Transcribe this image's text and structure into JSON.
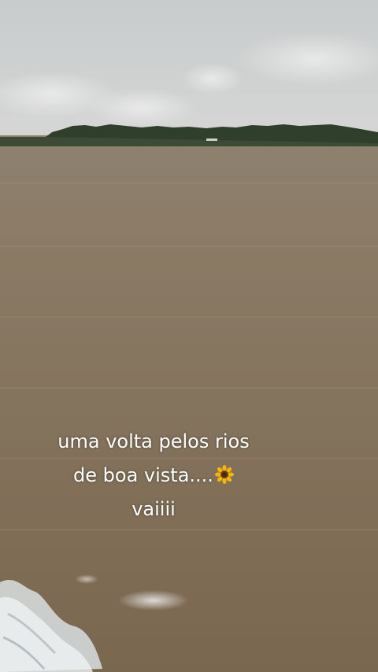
{
  "caption": {
    "line1": "uma volta pelos rios",
    "line2": "de boa vista....",
    "line3": "vaiiii",
    "emoji_icon": "sunflower-icon"
  },
  "colors": {
    "sky": "#cdd0d0",
    "river": "#85735d",
    "treeline": "#2f3f2b",
    "caption_text": "#ffffff"
  }
}
